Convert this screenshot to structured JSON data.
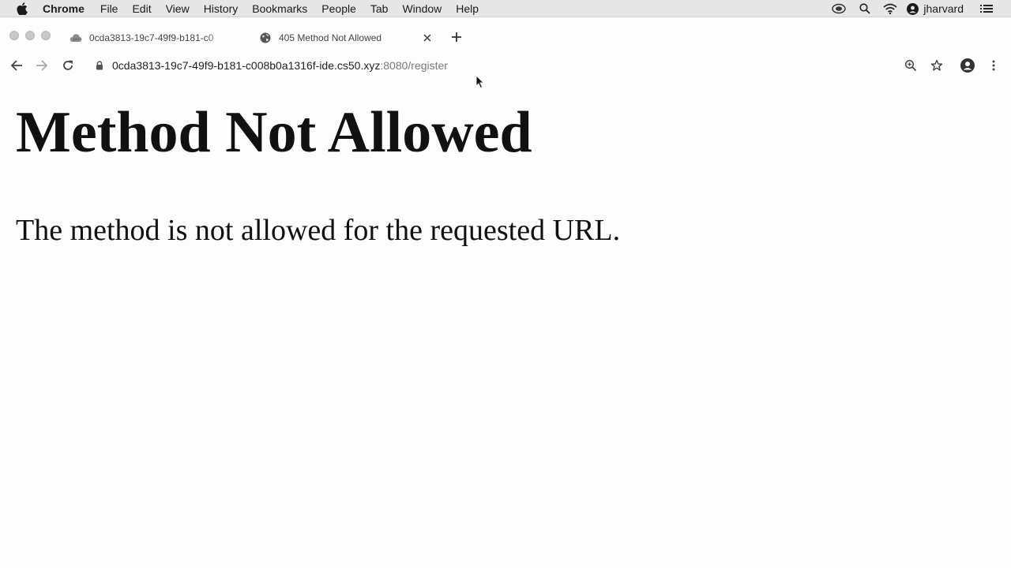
{
  "menubar": {
    "app_name": "Chrome",
    "items": [
      "File",
      "Edit",
      "View",
      "History",
      "Bookmarks",
      "People",
      "Tab",
      "Window",
      "Help"
    ],
    "user_name": "jharvard"
  },
  "tabs": [
    {
      "title": "0cda3813-19c7-49f9-b181-c0",
      "favicon": "cloud9-icon",
      "active": false
    },
    {
      "title": "405 Method Not Allowed",
      "favicon": "globe-icon",
      "active": true
    }
  ],
  "address_bar": {
    "host": "0cda3813-19c7-49f9-b181-c008b0a1316f-ide.cs50.xyz",
    "rest": ":8080/register"
  },
  "page": {
    "heading": "Method Not Allowed",
    "message": "The method is not allowed for the requested URL."
  },
  "colors": {
    "menubar_bg": "#e6e6e6",
    "page_bg": "#fdfdfd",
    "text": "#111111"
  }
}
